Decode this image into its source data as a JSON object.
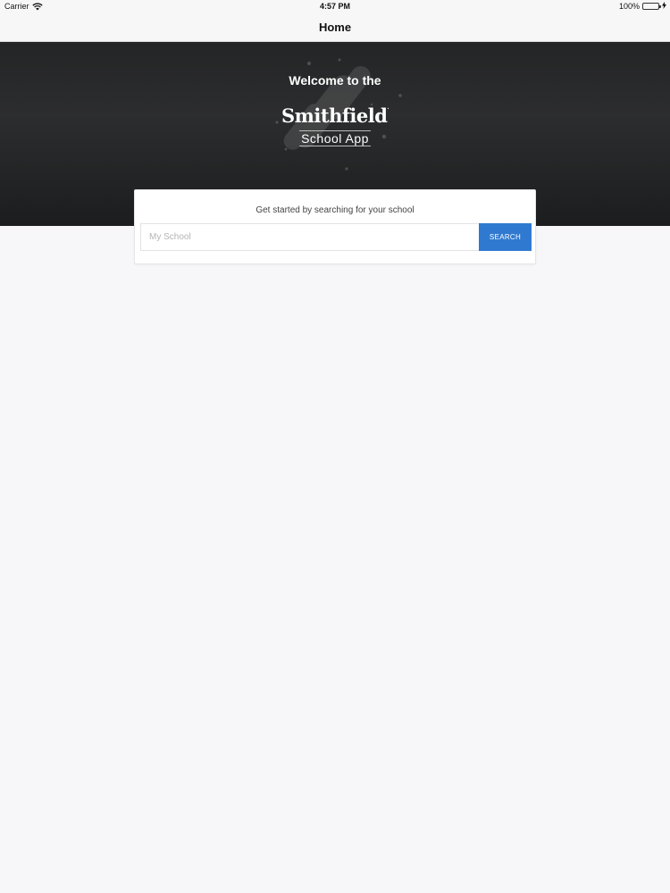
{
  "status_bar": {
    "carrier": "Carrier",
    "time": "4:57 PM",
    "battery": "100%",
    "battery_level": 1.0,
    "icons": [
      "wifi-icon",
      "battery-icon",
      "charging-icon"
    ],
    "battery_color": "#4cd964"
  },
  "nav": {
    "title": "Home"
  },
  "hero": {
    "welcome": "Welcome to the",
    "brand": "Smithfield",
    "brand_mark": ".",
    "app_name": "School App"
  },
  "search": {
    "prompt": "Get started by searching for your school",
    "placeholder": "My School",
    "value": "",
    "button_label": "SEARCH",
    "accent_color": "#2f7ad0"
  }
}
